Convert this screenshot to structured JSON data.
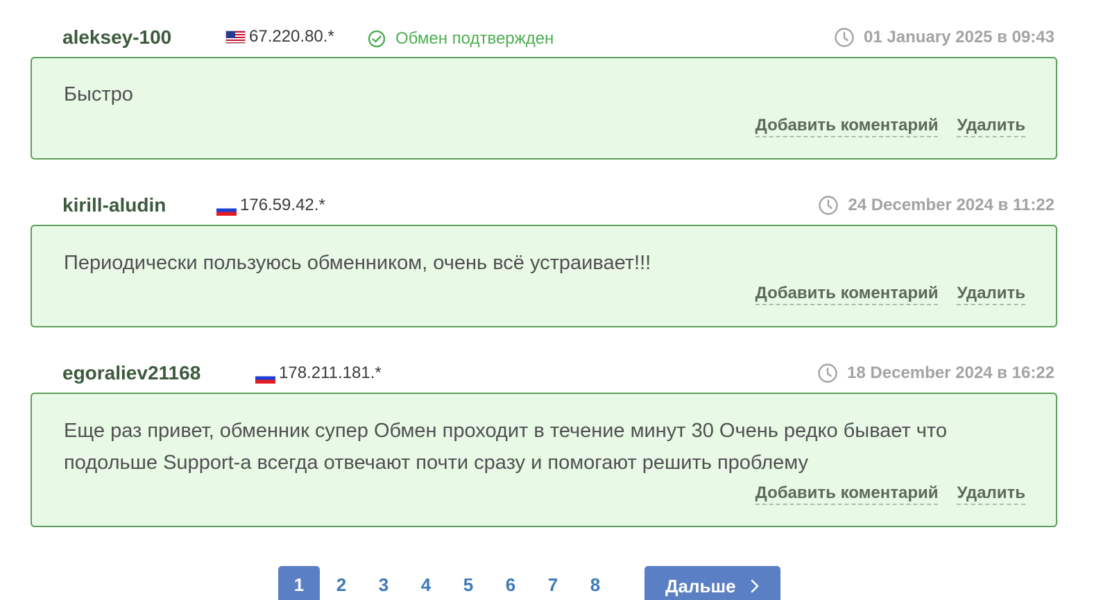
{
  "reviews": [
    {
      "username": "aleksey-100",
      "flag": "us-flag-icon",
      "ip": "67.220.80.*",
      "status": "Обмен подтвержден",
      "date": "01 January 2025 в 09:43",
      "text": "Быстро",
      "add_comment_label": "Добавить коментарий",
      "delete_label": "Удалить"
    },
    {
      "username": "kirill-aludin",
      "flag": "ru-flag-icon",
      "ip": "176.59.42.*",
      "date": "24 December 2024 в 11:22",
      "text": "Периодически пользуюсь обменником, очень всё устраивает!!!",
      "add_comment_label": "Добавить коментарий",
      "delete_label": "Удалить"
    },
    {
      "username": "egoraliev21168",
      "flag": "ru-flag-icon",
      "ip": "178.211.181.*",
      "date": "18 December 2024 в 16:22",
      "text": "Еще раз привет, обменник супер Обмен проходит в течение минут 30 Очень редко бывает что подольше Support-а всегда отвечают почти сразу и помогают решить проблему",
      "add_comment_label": "Добавить коментарий",
      "delete_label": "Удалить"
    }
  ],
  "pagination": {
    "pages": [
      "1",
      "2",
      "3",
      "4",
      "5",
      "6",
      "7",
      "8"
    ],
    "current": "1",
    "next_label": "Дальше"
  },
  "colors": {
    "card_background": "#e8f9e6",
    "card_border": "#5aa05a",
    "status_green": "#4caf50",
    "username": "#3d5a3d",
    "date_gray": "#a3a3a3",
    "pagination_active": "#5b7fc4",
    "pagination_link": "#3d7ab8"
  }
}
